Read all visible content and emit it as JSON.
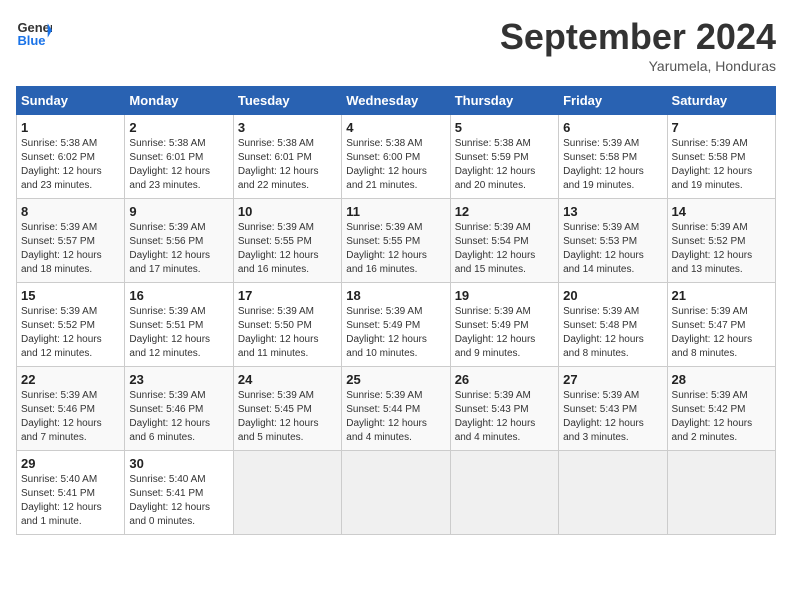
{
  "header": {
    "logo_line1": "General",
    "logo_line2": "Blue",
    "month": "September 2024",
    "location": "Yarumela, Honduras"
  },
  "days_of_week": [
    "Sunday",
    "Monday",
    "Tuesday",
    "Wednesday",
    "Thursday",
    "Friday",
    "Saturday"
  ],
  "weeks": [
    [
      {
        "day": "1",
        "info": "Sunrise: 5:38 AM\nSunset: 6:02 PM\nDaylight: 12 hours\nand 23 minutes."
      },
      {
        "day": "2",
        "info": "Sunrise: 5:38 AM\nSunset: 6:01 PM\nDaylight: 12 hours\nand 23 minutes."
      },
      {
        "day": "3",
        "info": "Sunrise: 5:38 AM\nSunset: 6:01 PM\nDaylight: 12 hours\nand 22 minutes."
      },
      {
        "day": "4",
        "info": "Sunrise: 5:38 AM\nSunset: 6:00 PM\nDaylight: 12 hours\nand 21 minutes."
      },
      {
        "day": "5",
        "info": "Sunrise: 5:38 AM\nSunset: 5:59 PM\nDaylight: 12 hours\nand 20 minutes."
      },
      {
        "day": "6",
        "info": "Sunrise: 5:39 AM\nSunset: 5:58 PM\nDaylight: 12 hours\nand 19 minutes."
      },
      {
        "day": "7",
        "info": "Sunrise: 5:39 AM\nSunset: 5:58 PM\nDaylight: 12 hours\nand 19 minutes."
      }
    ],
    [
      {
        "day": "8",
        "info": "Sunrise: 5:39 AM\nSunset: 5:57 PM\nDaylight: 12 hours\nand 18 minutes."
      },
      {
        "day": "9",
        "info": "Sunrise: 5:39 AM\nSunset: 5:56 PM\nDaylight: 12 hours\nand 17 minutes."
      },
      {
        "day": "10",
        "info": "Sunrise: 5:39 AM\nSunset: 5:55 PM\nDaylight: 12 hours\nand 16 minutes."
      },
      {
        "day": "11",
        "info": "Sunrise: 5:39 AM\nSunset: 5:55 PM\nDaylight: 12 hours\nand 16 minutes."
      },
      {
        "day": "12",
        "info": "Sunrise: 5:39 AM\nSunset: 5:54 PM\nDaylight: 12 hours\nand 15 minutes."
      },
      {
        "day": "13",
        "info": "Sunrise: 5:39 AM\nSunset: 5:53 PM\nDaylight: 12 hours\nand 14 minutes."
      },
      {
        "day": "14",
        "info": "Sunrise: 5:39 AM\nSunset: 5:52 PM\nDaylight: 12 hours\nand 13 minutes."
      }
    ],
    [
      {
        "day": "15",
        "info": "Sunrise: 5:39 AM\nSunset: 5:52 PM\nDaylight: 12 hours\nand 12 minutes."
      },
      {
        "day": "16",
        "info": "Sunrise: 5:39 AM\nSunset: 5:51 PM\nDaylight: 12 hours\nand 12 minutes."
      },
      {
        "day": "17",
        "info": "Sunrise: 5:39 AM\nSunset: 5:50 PM\nDaylight: 12 hours\nand 11 minutes."
      },
      {
        "day": "18",
        "info": "Sunrise: 5:39 AM\nSunset: 5:49 PM\nDaylight: 12 hours\nand 10 minutes."
      },
      {
        "day": "19",
        "info": "Sunrise: 5:39 AM\nSunset: 5:49 PM\nDaylight: 12 hours\nand 9 minutes."
      },
      {
        "day": "20",
        "info": "Sunrise: 5:39 AM\nSunset: 5:48 PM\nDaylight: 12 hours\nand 8 minutes."
      },
      {
        "day": "21",
        "info": "Sunrise: 5:39 AM\nSunset: 5:47 PM\nDaylight: 12 hours\nand 8 minutes."
      }
    ],
    [
      {
        "day": "22",
        "info": "Sunrise: 5:39 AM\nSunset: 5:46 PM\nDaylight: 12 hours\nand 7 minutes."
      },
      {
        "day": "23",
        "info": "Sunrise: 5:39 AM\nSunset: 5:46 PM\nDaylight: 12 hours\nand 6 minutes."
      },
      {
        "day": "24",
        "info": "Sunrise: 5:39 AM\nSunset: 5:45 PM\nDaylight: 12 hours\nand 5 minutes."
      },
      {
        "day": "25",
        "info": "Sunrise: 5:39 AM\nSunset: 5:44 PM\nDaylight: 12 hours\nand 4 minutes."
      },
      {
        "day": "26",
        "info": "Sunrise: 5:39 AM\nSunset: 5:43 PM\nDaylight: 12 hours\nand 4 minutes."
      },
      {
        "day": "27",
        "info": "Sunrise: 5:39 AM\nSunset: 5:43 PM\nDaylight: 12 hours\nand 3 minutes."
      },
      {
        "day": "28",
        "info": "Sunrise: 5:39 AM\nSunset: 5:42 PM\nDaylight: 12 hours\nand 2 minutes."
      }
    ],
    [
      {
        "day": "29",
        "info": "Sunrise: 5:40 AM\nSunset: 5:41 PM\nDaylight: 12 hours\nand 1 minute."
      },
      {
        "day": "30",
        "info": "Sunrise: 5:40 AM\nSunset: 5:41 PM\nDaylight: 12 hours\nand 0 minutes."
      },
      {
        "day": "",
        "info": ""
      },
      {
        "day": "",
        "info": ""
      },
      {
        "day": "",
        "info": ""
      },
      {
        "day": "",
        "info": ""
      },
      {
        "day": "",
        "info": ""
      }
    ]
  ]
}
